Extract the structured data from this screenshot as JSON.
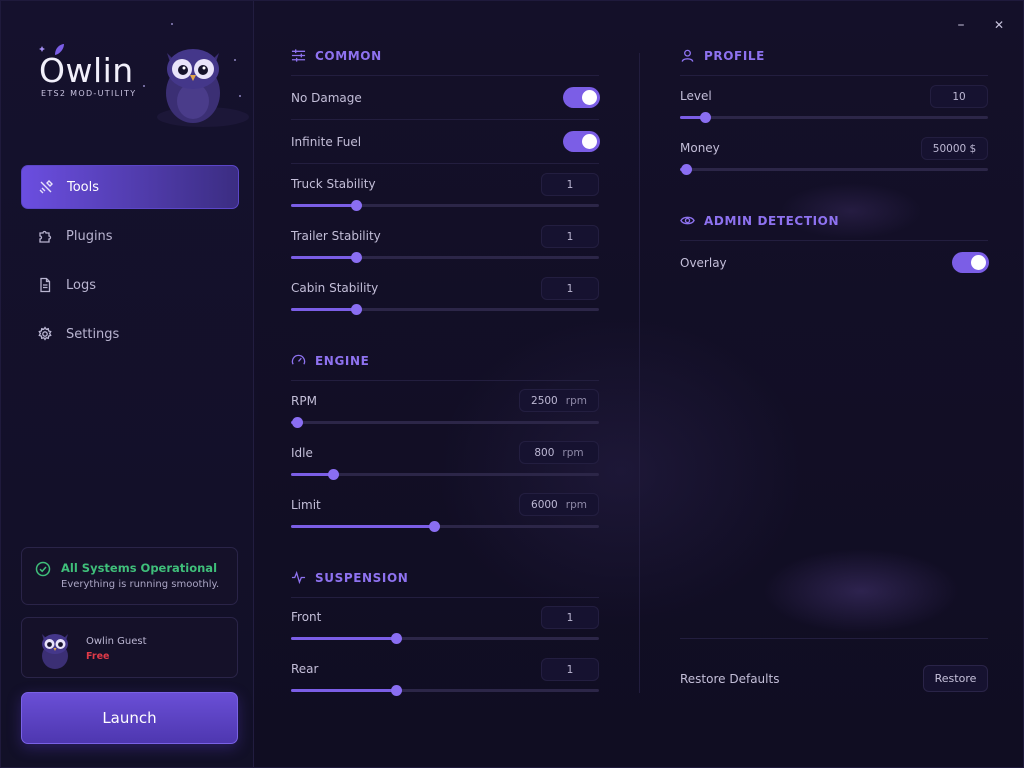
{
  "app": {
    "logo_text": "Owlin",
    "logo_subtitle": "ETS2 MOD-UTILITY"
  },
  "window": {
    "minimize_glyph": "–",
    "close_glyph": "✕"
  },
  "nav": {
    "items": [
      {
        "label": "Tools",
        "icon": "tools-icon",
        "active": true
      },
      {
        "label": "Plugins",
        "icon": "puzzle-icon",
        "active": false
      },
      {
        "label": "Logs",
        "icon": "document-icon",
        "active": false
      },
      {
        "label": "Settings",
        "icon": "gear-icon",
        "active": false
      }
    ]
  },
  "status": {
    "title": "All Systems Operational",
    "subtitle": "Everything is running smoothly.",
    "color": "#3fbf7a"
  },
  "user": {
    "name": "Owlin Guest",
    "plan": "Free",
    "plan_color": "#e03a48"
  },
  "launch_label": "Launch",
  "accent": "#7b5ee6",
  "common": {
    "title": "COMMON",
    "no_damage": {
      "label": "No Damage",
      "on": true
    },
    "infinite_fuel": {
      "label": "Infinite Fuel",
      "on": true
    },
    "truck_stability": {
      "label": "Truck Stability",
      "value": "1",
      "slider_fraction": 0.21
    },
    "trailer_stability": {
      "label": "Trailer Stability",
      "value": "1",
      "slider_fraction": 0.21
    },
    "cabin_stability": {
      "label": "Cabin Stability",
      "value": "1",
      "slider_fraction": 0.21
    }
  },
  "engine": {
    "title": "ENGINE",
    "rpm": {
      "label": "RPM",
      "value": "2500",
      "unit": "rpm",
      "slider_fraction": 0.02
    },
    "idle": {
      "label": "Idle",
      "value": "800",
      "unit": "rpm",
      "slider_fraction": 0.135
    },
    "limit": {
      "label": "Limit",
      "value": "6000",
      "unit": "rpm",
      "slider_fraction": 0.465
    }
  },
  "suspension": {
    "title": "SUSPENSION",
    "front": {
      "label": "Front",
      "value": "1",
      "slider_fraction": 0.34
    },
    "rear": {
      "label": "Rear",
      "value": "1",
      "slider_fraction": 0.34
    }
  },
  "profile": {
    "title": "PROFILE",
    "level": {
      "label": "Level",
      "value": "10",
      "slider_fraction": 0.08
    },
    "money": {
      "label": "Money",
      "value": "50000 $",
      "slider_fraction": 0.02
    }
  },
  "admin": {
    "title": "ADMIN DETECTION",
    "overlay": {
      "label": "Overlay",
      "on": true
    }
  },
  "restore": {
    "label": "Restore Defaults",
    "button": "Restore"
  }
}
